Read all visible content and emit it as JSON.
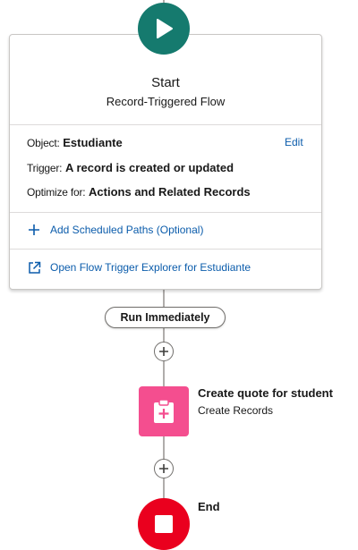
{
  "start": {
    "title": "Start",
    "subtitle": "Record-Triggered Flow",
    "object_label": "Object:",
    "object_value": "Estudiante",
    "edit_label": "Edit",
    "trigger_label": "Trigger:",
    "trigger_value": "A record is created or updated",
    "optimize_label": "Optimize for:",
    "optimize_value": "Actions and Related Records",
    "scheduled_paths_link": "Add Scheduled Paths (Optional)",
    "explorer_link": "Open Flow Trigger Explorer for Estudiante"
  },
  "path": {
    "label": "Run Immediately"
  },
  "elements": [
    {
      "title": "Create quote for student",
      "subtitle": "Create Records",
      "icon": "clipboard-plus-icon",
      "color": "#f44e8f"
    }
  ],
  "end": {
    "label": "End",
    "color": "#ea001e"
  },
  "colors": {
    "start": "#157a6e",
    "link": "#0b5cab",
    "connector": "#b0adab"
  }
}
